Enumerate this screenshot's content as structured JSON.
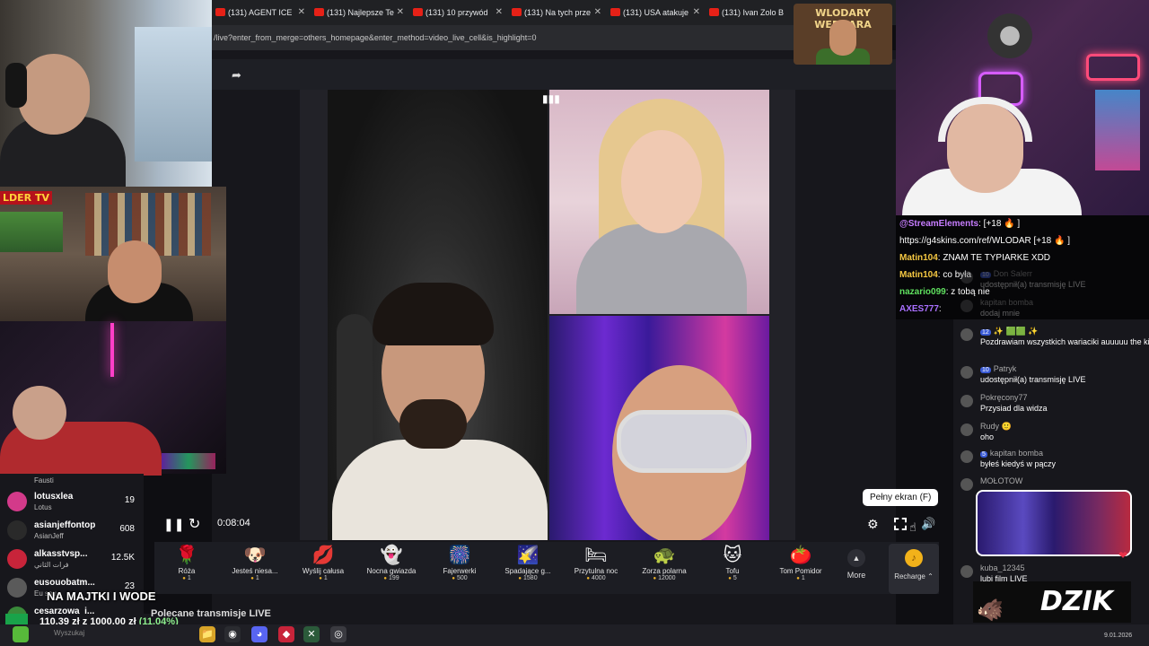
{
  "browser": {
    "tabs": [
      "(131) AGENT ICE",
      "(131) Najlepsze Te",
      "(131) 10 przywód",
      "(131) Na tych prze",
      "(131) USA atakuje",
      "(131) Ivan Zolo B"
    ],
    "url": "/live?enter_from_merge=others_homepage&enter_method=video_live_cell&is_highlight=0"
  },
  "overlay": {
    "channel_logo": "WLODARY WEDDARA",
    "left_logo": "LDER TV",
    "title": "NA MAJTKI I WODE",
    "donation_text": "110,39 zł z 1000,00 zł",
    "donation_pct": "(11.04%)",
    "donation_fraction": 0.1104,
    "brand": "DZIK"
  },
  "player": {
    "time": "0:08:04",
    "tooltip": "Pełny ekran (F)"
  },
  "gifts": [
    {
      "icon": "🌹",
      "name": "Róża",
      "cost": "1"
    },
    {
      "icon": "🐶",
      "name": "Jesteś niesa...",
      "cost": "1"
    },
    {
      "icon": "💋",
      "name": "Wyślij całusa",
      "cost": "1"
    },
    {
      "icon": "👻",
      "name": "Nocna gwiazda",
      "cost": "199"
    },
    {
      "icon": "🎆",
      "name": "Fajerwerki",
      "cost": "500"
    },
    {
      "icon": "🌠",
      "name": "Spadające g...",
      "cost": "1580"
    },
    {
      "icon": "🛏",
      "name": "Przytulna noc",
      "cost": "4000"
    },
    {
      "icon": "🐢",
      "name": "Zorza polarna",
      "cost": "12000"
    },
    {
      "icon": "🐱",
      "name": "Tofu",
      "cost": "5"
    },
    {
      "icon": "🍅",
      "name": "Tom Pomidor",
      "cost": "1"
    }
  ],
  "gift_bar": {
    "more_label": "More",
    "recharge_label": "Recharge ⌃"
  },
  "leaderboard": {
    "top_sub": "Fausti",
    "items": [
      {
        "name": "lotusxlea",
        "sub": "Lotus",
        "points": "19",
        "color": "#d33a8a"
      },
      {
        "name": "asianjeffontop",
        "sub": "AsianJeff",
        "points": "608",
        "color": "#2a2a2a"
      },
      {
        "name": "alkasstvsp...",
        "sub": "فرات الثاني",
        "points": "12.5K",
        "color": "#c8243a"
      },
      {
        "name": "eusouobatm...",
        "sub": "Eu sou...",
        "points": "23",
        "color": "#5a5a5a"
      },
      {
        "name": "cesarzowa_i...",
        "sub": "",
        "points": "",
        "color": "#3a8a3a"
      }
    ]
  },
  "recommended": "Polecane transmisje LIVE",
  "taskbar_search": "Wyszukaj",
  "clock_year": "9.01.2026",
  "se_chat": [
    {
      "user": "@StreamElements",
      "text": ": [+18 🔥 ]",
      "color": "#c77dff"
    },
    {
      "user": "",
      "text": "https://g4skins.com/ref/WLODAR [+18 🔥 ]",
      "color": "#ffffff"
    },
    {
      "user": "Matin104",
      "text": ": ZNAM TE TYPIARKE XDD",
      "color": "#f5c842"
    },
    {
      "user": "Matin104",
      "text": ": co była",
      "color": "#f5c842"
    },
    {
      "user": "nazario099",
      "text": ": z tobą nie",
      "color": "#5fe05f"
    },
    {
      "user": "AXES777",
      "text": ":",
      "color": "#a970ff"
    }
  ],
  "tt_chat": [
    {
      "level": "10",
      "name": "Don Salerr",
      "text": "udostępnił(a) transmisję LIVE",
      "faded": true
    },
    {
      "level": "",
      "name": "kapitan bomba",
      "text": "dodaj mnie",
      "faded": true
    },
    {
      "level": "12",
      "name": "✨ 🟩🟩 ✨",
      "text": "Pozdrawiam wszystkich wariaciki auuuuu the king is back",
      "faded": false
    },
    {
      "level": "10",
      "name": "Patryk",
      "text": "udostępnił(a) transmisję LIVE",
      "faded": false
    },
    {
      "level": "",
      "name": "Pokręcony77",
      "text": "Przysiad dla widza",
      "faded": false
    },
    {
      "level": "",
      "name": "Rudy 🙂",
      "text": "oho",
      "faded": false
    },
    {
      "level": "5",
      "name": "kapitan bomba",
      "text": "byłeś kiedyś w pączy",
      "faded": false
    },
    {
      "level": "",
      "name": "MOŁOTOW",
      "text": "",
      "faded": false
    },
    {
      "level": "",
      "name": "kuba_12345",
      "text": "lubi film LIVE",
      "faded": false
    }
  ]
}
